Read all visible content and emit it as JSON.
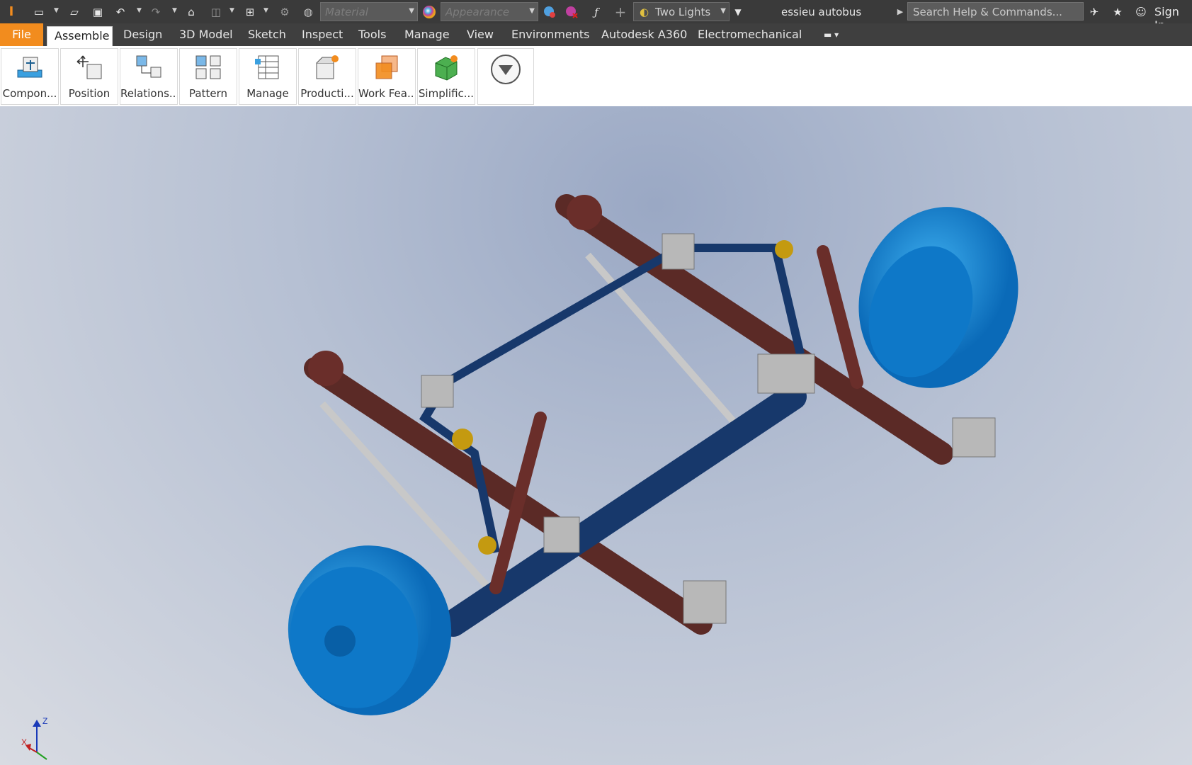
{
  "app": {
    "document_title": "essieu autobus"
  },
  "quick_access": {
    "material_placeholder": "Material",
    "appearance_placeholder": "Appearance",
    "lighting": "Two Lights",
    "search_placeholder": "Search Help & Commands...",
    "sign_in": "Sign In"
  },
  "tabs": [
    {
      "label": "File"
    },
    {
      "label": "Assemble"
    },
    {
      "label": "Design"
    },
    {
      "label": "3D Model"
    },
    {
      "label": "Sketch"
    },
    {
      "label": "Inspect"
    },
    {
      "label": "Tools"
    },
    {
      "label": "Manage"
    },
    {
      "label": "View"
    },
    {
      "label": "Environments"
    },
    {
      "label": "Autodesk A360"
    },
    {
      "label": "Electromechanical"
    }
  ],
  "ribbon": {
    "buttons": [
      {
        "label": "Compon..."
      },
      {
        "label": "Position"
      },
      {
        "label": "Relations..."
      },
      {
        "label": "Pattern"
      },
      {
        "label": "Manage"
      },
      {
        "label": "Producti..."
      },
      {
        "label": "Work Fea..."
      },
      {
        "label": "Simplific..."
      }
    ]
  },
  "triad": {
    "x": "X",
    "z": "Z"
  },
  "colors": {
    "file_tab": "#f28c1e",
    "wheel": "#1287d6",
    "spring": "#5b2a26",
    "rod": "#17386b",
    "bushing": "#c49a10",
    "metal": "#b8b8b8"
  }
}
